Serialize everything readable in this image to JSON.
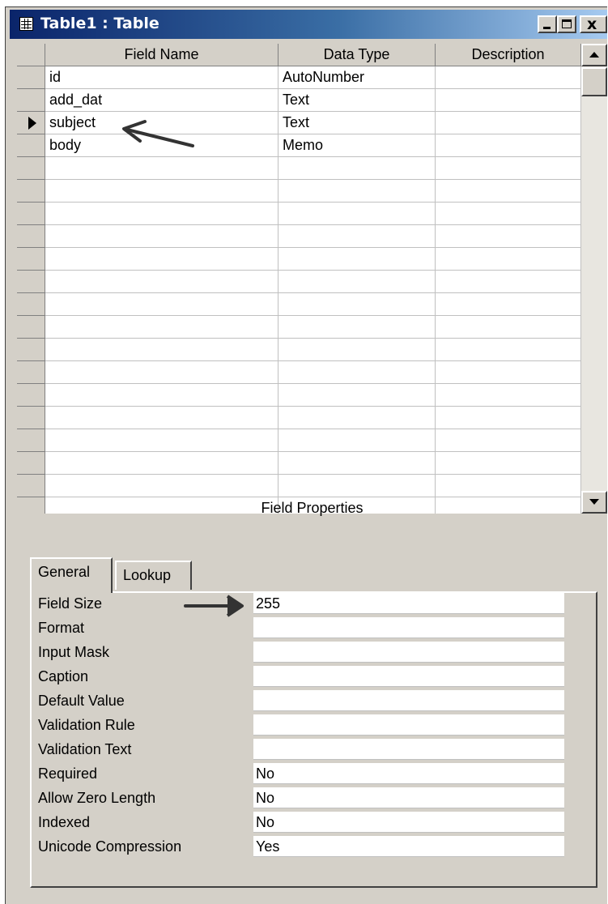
{
  "window": {
    "title": "Table1 : Table",
    "close_glyph": "x"
  },
  "columns": [
    "Field Name",
    "Data Type",
    "Description"
  ],
  "rows": [
    {
      "field_name": "id",
      "data_type": "AutoNumber",
      "description": ""
    },
    {
      "field_name": "add_dat",
      "data_type": "Text",
      "description": ""
    },
    {
      "field_name": "subject",
      "data_type": "Text",
      "description": "",
      "current": true
    },
    {
      "field_name": "body",
      "data_type": "Memo",
      "description": ""
    }
  ],
  "field_properties": {
    "title": "Field Properties",
    "tabs": [
      "General",
      "Lookup"
    ],
    "active_tab": "General",
    "properties": [
      {
        "label": "Field Size",
        "value": "255"
      },
      {
        "label": "Format",
        "value": ""
      },
      {
        "label": "Input Mask",
        "value": ""
      },
      {
        "label": "Caption",
        "value": ""
      },
      {
        "label": "Default Value",
        "value": ""
      },
      {
        "label": "Validation Rule",
        "value": ""
      },
      {
        "label": "Validation Text",
        "value": ""
      },
      {
        "label": "Required",
        "value": "No"
      },
      {
        "label": "Allow Zero Length",
        "value": "No"
      },
      {
        "label": "Indexed",
        "value": "No"
      },
      {
        "label": "Unicode Compression",
        "value": "Yes"
      }
    ]
  },
  "icons": {
    "title": "table-icon",
    "minimize": "minimize-icon",
    "maximize": "maximize-icon",
    "close": "close-icon",
    "current_row": "current-row-pointer-icon",
    "annotations": "arrow-icon"
  },
  "colors": {
    "title_bar_start": "#0a246a",
    "title_bar_end": "#a6caf0",
    "chrome": "#d4d0c8"
  }
}
